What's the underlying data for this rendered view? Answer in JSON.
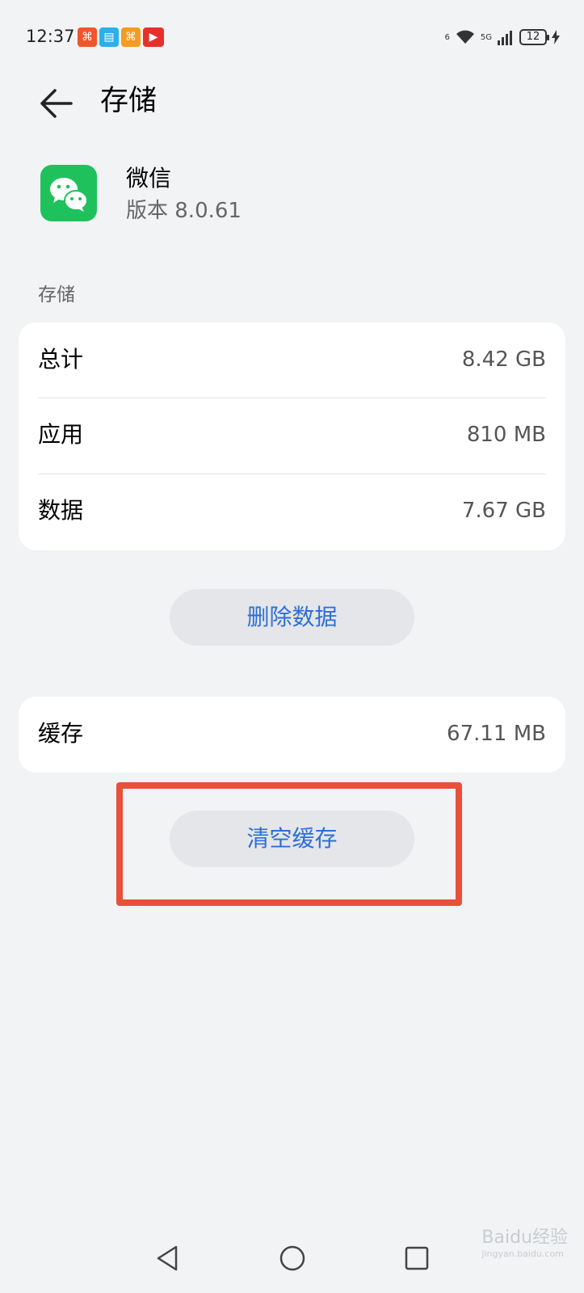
{
  "status_bar": {
    "time": "12:37",
    "notification_icons": [
      "cloud-app-icon",
      "reader-app-icon",
      "shop-app-icon",
      "video-app-icon"
    ],
    "network_label": "5G",
    "wifi_label": "6",
    "battery_level": "12"
  },
  "header": {
    "title": "存储"
  },
  "app": {
    "name": "微信",
    "version": "版本 8.0.61",
    "icon_color": "#1fc15d"
  },
  "storage_section": {
    "label": "存储",
    "rows": [
      {
        "label": "总计",
        "value": "8.42 GB"
      },
      {
        "label": "应用",
        "value": "810 MB"
      },
      {
        "label": "数据",
        "value": "7.67 GB"
      }
    ]
  },
  "delete_data_button": "删除数据",
  "cache": {
    "label": "缓存",
    "value": "67.11 MB"
  },
  "clear_cache_button": "清空缓存",
  "highlight_color": "#e8503a",
  "accent_color": "#2d6ed8",
  "watermark": {
    "text": "Baidu经验",
    "url": "jingyan.baidu.com"
  }
}
